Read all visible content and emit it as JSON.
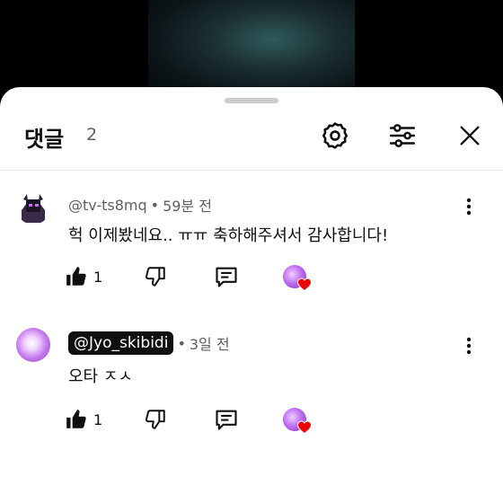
{
  "header": {
    "title": "댓글",
    "count": "2"
  },
  "icons": {
    "settings": "gear-icon",
    "filter": "sliders-icon",
    "close": "close-icon",
    "like": "thumbs-up-icon",
    "dislike": "thumbs-down-icon",
    "reply": "reply-icon",
    "more": "more-vertical-icon",
    "heart": "heart-icon"
  },
  "comments": [
    {
      "author": "@tv-ts8mq",
      "highlighted": false,
      "separator": "•",
      "time": "59분 전",
      "text": "헉 이제봤네요.. ㅠㅠ 축하해주셔서 감사합니다!",
      "likes": "1"
    },
    {
      "author": "@Jyo_skibidi",
      "highlighted": true,
      "separator": "•",
      "time": "3일 전",
      "text": "오타 ㅈㅅ",
      "likes": "1"
    }
  ],
  "colors": {
    "heart": "#e00",
    "text": "#0f0f0f",
    "secondary": "#606060"
  }
}
